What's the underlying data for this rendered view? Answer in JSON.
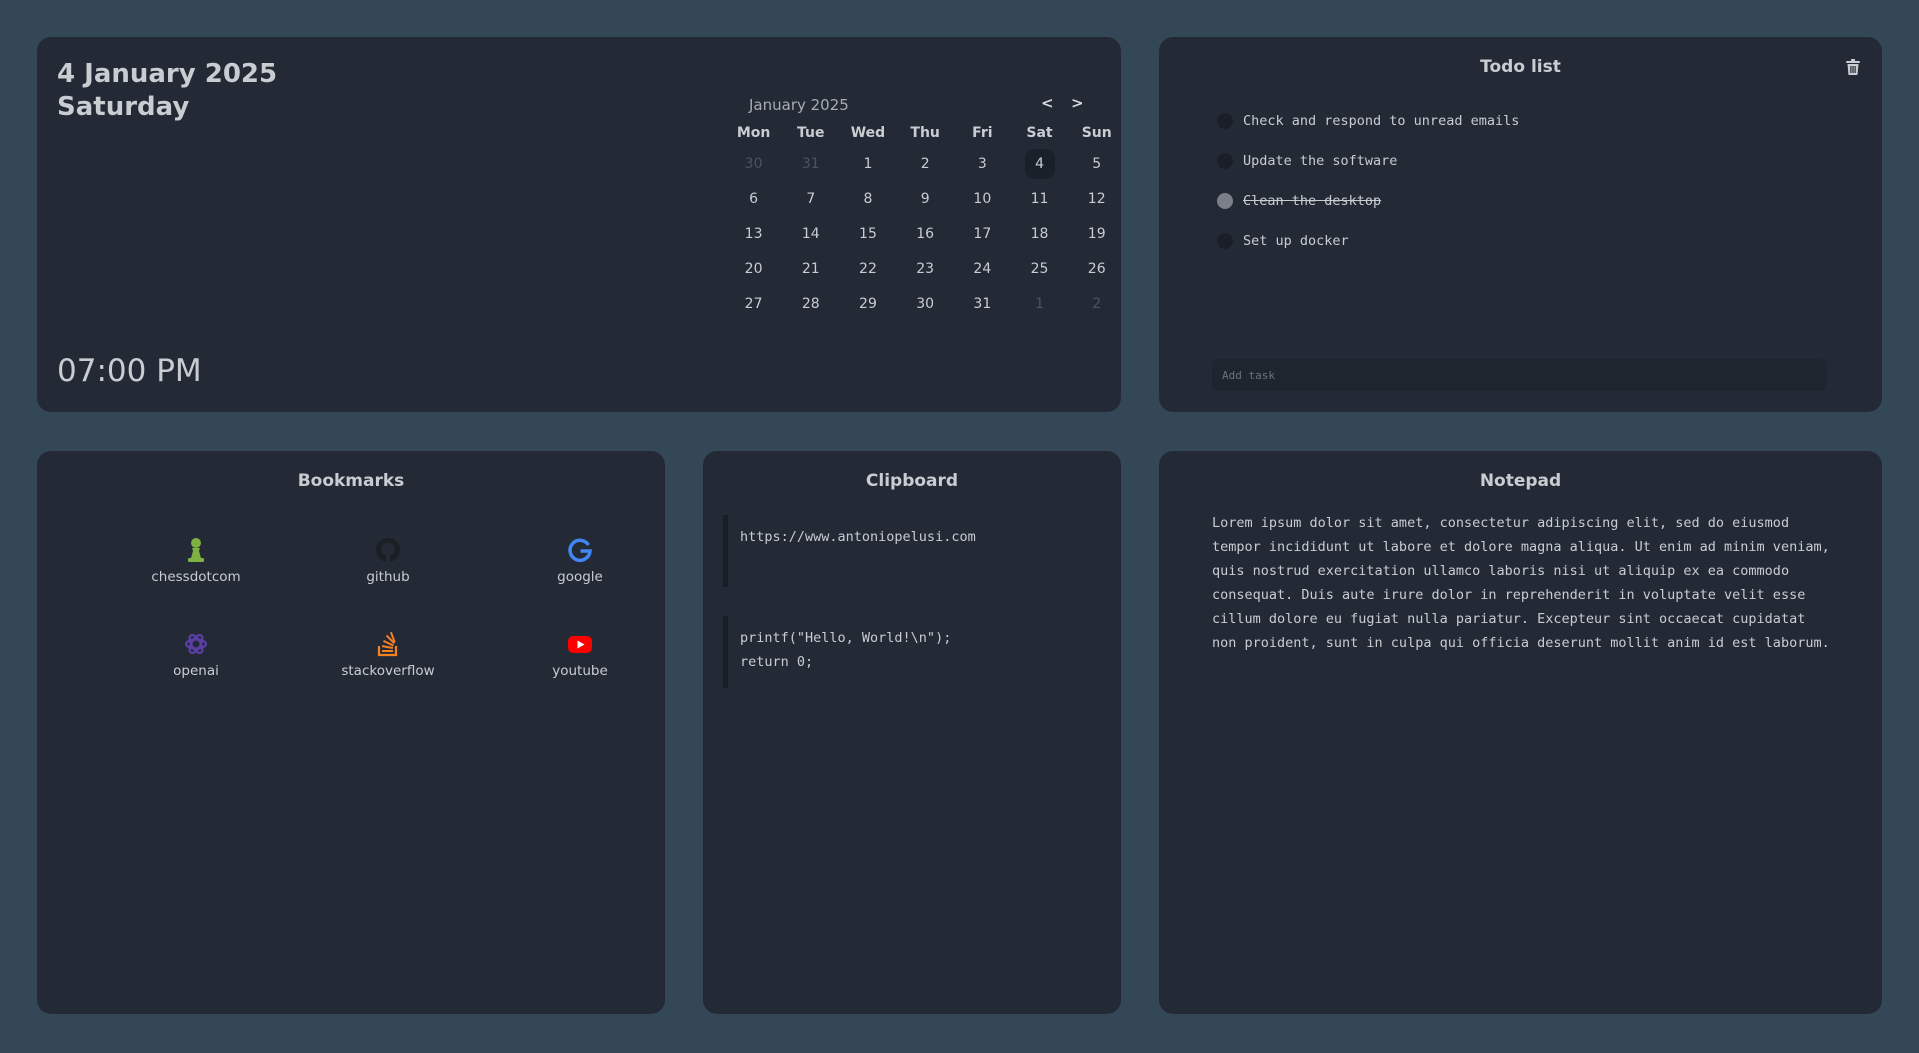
{
  "date": {
    "main": "4 January 2025",
    "weekday": "Saturday",
    "time": "07:00 PM"
  },
  "calendar": {
    "month_label": "January 2025",
    "prev": "<",
    "next": ">",
    "weekdays": [
      "Mon",
      "Tue",
      "Wed",
      "Thu",
      "Fri",
      "Sat",
      "Sun"
    ],
    "weeks": [
      [
        "30",
        "31",
        "1",
        "2",
        "3",
        "4",
        "5"
      ],
      [
        "6",
        "7",
        "8",
        "9",
        "10",
        "11",
        "12"
      ],
      [
        "13",
        "14",
        "15",
        "16",
        "17",
        "18",
        "19"
      ],
      [
        "20",
        "21",
        "22",
        "23",
        "24",
        "25",
        "26"
      ],
      [
        "27",
        "28",
        "29",
        "30",
        "31",
        "1",
        "2"
      ]
    ],
    "muted_first_row": [
      "30",
      "31"
    ],
    "muted_last_row": [
      "1",
      "2"
    ],
    "today": "4"
  },
  "todo": {
    "title": "Todo list",
    "items": [
      {
        "text": "Check and respond to unread emails",
        "done": false
      },
      {
        "text": "Update the software",
        "done": false
      },
      {
        "text": "Clean the desktop",
        "done": true
      },
      {
        "text": "Set up docker",
        "done": false
      }
    ],
    "add_placeholder": "Add task"
  },
  "bookmarks": {
    "title": "Bookmarks",
    "items": [
      {
        "label": "chessdotcom",
        "icon": "chess-pawn-icon",
        "color": "#7fb044"
      },
      {
        "label": "github",
        "icon": "github-icon",
        "color": "#1b1f24"
      },
      {
        "label": "google",
        "icon": "google-icon",
        "color": "#4285f4"
      },
      {
        "label": "openai",
        "icon": "openai-icon",
        "color": "#5b3fa8"
      },
      {
        "label": "stackoverflow",
        "icon": "stackoverflow-icon",
        "color": "#f48024"
      },
      {
        "label": "youtube",
        "icon": "youtube-icon",
        "color": "#ff0000"
      }
    ]
  },
  "clipboard": {
    "title": "Clipboard",
    "items": [
      "https://www.antoniopelusi.com",
      "printf(\"Hello, World!\\n\");\nreturn 0;"
    ]
  },
  "notepad": {
    "title": "Notepad",
    "text": "Lorem ipsum dolor sit amet, consectetur adipiscing elit, sed do eiusmod\ntempor incididunt ut labore et dolore magna aliqua. Ut enim ad minim veniam,\nquis nostrud exercitation ullamco laboris nisi ut aliquip ex ea commodo\nconsequat. Duis aute irure dolor in reprehenderit in voluptate velit esse\ncillum dolore eu fugiat nulla pariatur. Excepteur sint occaecat cupidatat\nnon proident, sunt in culpa qui officia deserunt mollit anim id est laborum."
  }
}
